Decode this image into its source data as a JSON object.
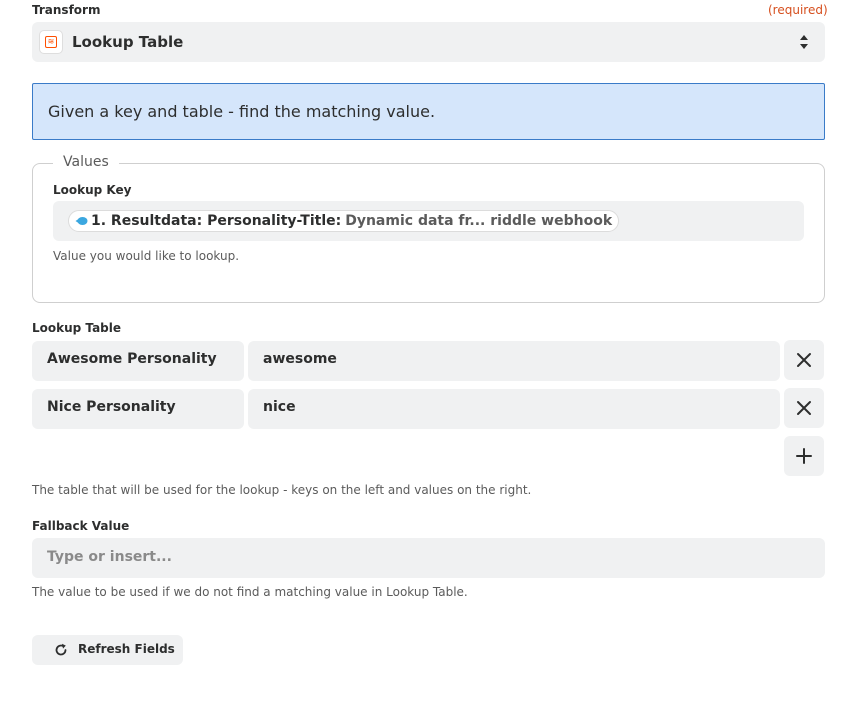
{
  "transform": {
    "label": "Transform",
    "required_text": "(required)",
    "selected_value": "Lookup Table",
    "app_icon": "lookup-table-app-icon",
    "app_icon_glyph": "≋",
    "accent_color": "#ff4f00"
  },
  "info_banner": {
    "text": "Given a key and table - find the matching value."
  },
  "values": {
    "legend": "Values",
    "lookup_key": {
      "label": "Lookup Key",
      "pill_bold": "1. Resultdata: Personality-Title:",
      "pill_rest": "Dynamic data fr... riddle webhook",
      "pill_icon": "riddle-app-icon",
      "help": "Value you would like to lookup."
    }
  },
  "lookup_table": {
    "label": "Lookup Table",
    "rows": [
      {
        "key": "Awesome Personality",
        "value": "awesome"
      },
      {
        "key": "Nice Personality",
        "value": "nice"
      }
    ],
    "help": "The table that will be used for the lookup - keys on the left and values on the right."
  },
  "fallback": {
    "label": "Fallback Value",
    "placeholder": "Type or insert...",
    "help": "The value to be used if we do not find a matching value in Lookup Table."
  },
  "refresh": {
    "label": "Refresh Fields",
    "icon": "refresh-icon"
  },
  "colors": {
    "banner_bg": "#d5e6fb",
    "banner_border": "#3a7bc8",
    "required": "#d64f1e",
    "field_bg": "#f0f1f2"
  }
}
